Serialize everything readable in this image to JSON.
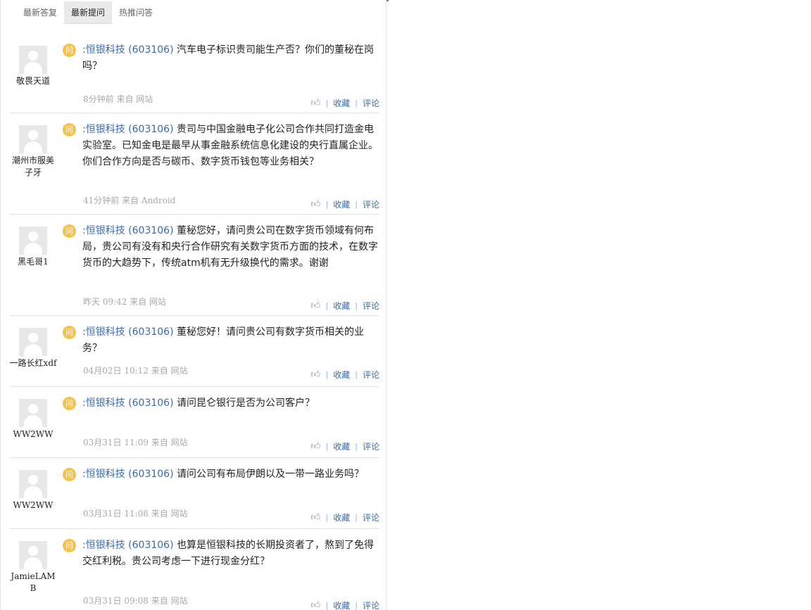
{
  "tabs": [
    "最新答复",
    "最新提问",
    "热推问答"
  ],
  "active_tab": 1,
  "actions": {
    "collect": "收藏",
    "comment": "评论"
  },
  "question_icon": "问",
  "questions": [
    {
      "user": "敬畏天道",
      "stock": ":恒银科技 (603106)",
      "text": "汽车电子标识贵司能生产否？你们的董秘在岗吗？",
      "meta": "8分钟前 来自 网站"
    },
    {
      "user": "潮州市服美子牙",
      "stock": ":恒银科技 (603106)",
      "text": "贵司与中国金融电子化公司合作共同打造金电实验室。已知金电是最早从事金融系统信息化建设的央行直属企业。你们合作方向是否与碳币、数字货币钱包等业务相关？",
      "meta": "41分钟前 来自 Android"
    },
    {
      "user": "黑毛哥1",
      "stock": ":恒银科技 (603106)",
      "text": "董秘您好，请问贵公司在数字货币领域有何布局，贵公司有没有和央行合作研究有关数字货币方面的技术，在数字货币的大趋势下，传统atm机有无升级换代的需求。谢谢",
      "meta": "昨天 09:42 来自 网站"
    },
    {
      "user": "一路长红xdf",
      "stock": ":恒银科技 (603106)",
      "text": "董秘您好！请问贵公司有数字货币相关的业务？",
      "meta": "04月02日 10:12 来自 网站"
    },
    {
      "user": "WW2WW",
      "stock": ":恒银科技 (603106)",
      "text": "请问昆仑银行是否为公司客户？",
      "meta": "03月31日 11:09 来自 网站"
    },
    {
      "user": "WW2WW",
      "stock": ":恒银科技 (603106)",
      "text": "请问公司有布局伊朗以及一带一路业务吗？",
      "meta": "03月31日 11:08 来自 网站"
    },
    {
      "user": "JamieLAMB",
      "stock": ":恒银科技 (603106)",
      "text": "也算是恒银科技的长期投资者了，熬到了免得交红利税。贵公司考虑一下进行现金分红？",
      "meta": "03月31日 09:08 来自 网站"
    }
  ]
}
